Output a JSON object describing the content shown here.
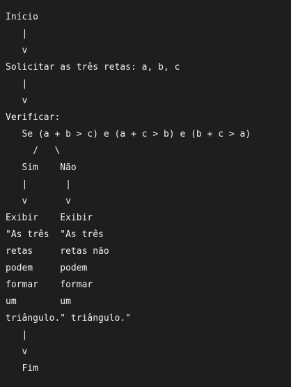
{
  "flowchart": {
    "lines": [
      "Início",
      "   |",
      "   v",
      "Solicitar as três retas: a, b, c",
      "   |",
      "   v",
      "Verificar:",
      "   Se (a + b > c) e (a + c > b) e (b + c > a)",
      "     /   \\",
      "   Sim    Não",
      "   |       |",
      "   v       v",
      "Exibir    Exibir",
      "\"As três  \"As três",
      "retas     retas não",
      "podem     podem",
      "formar    formar",
      "um        um",
      "triângulo.\" triângulo.\"",
      "   |",
      "   v",
      "   Fim"
    ]
  }
}
